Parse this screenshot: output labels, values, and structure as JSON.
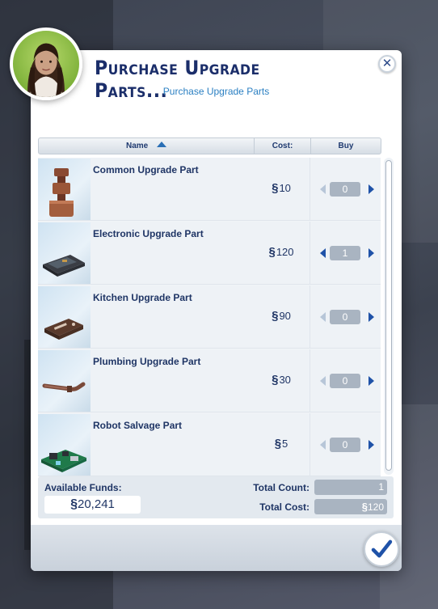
{
  "dialog": {
    "title": "Purchase Upgrade Parts...",
    "subtitle": "Purchase Upgrade Parts",
    "close_icon": "close-icon",
    "confirm_icon": "checkmark-icon"
  },
  "table": {
    "headers": {
      "name": "Name",
      "cost": "Cost:",
      "buy": "Buy"
    },
    "sort": "ascending",
    "items": [
      {
        "name": "Common Upgrade Part",
        "currency": "§",
        "cost": "10",
        "qty": "0",
        "icon": "copper-stack-icon"
      },
      {
        "name": "Electronic Upgrade Part",
        "currency": "§",
        "cost": "120",
        "qty": "1",
        "icon": "circuit-board-icon"
      },
      {
        "name": "Kitchen Upgrade Part",
        "currency": "§",
        "cost": "90",
        "qty": "0",
        "icon": "heating-plate-icon"
      },
      {
        "name": "Plumbing Upgrade Part",
        "currency": "§",
        "cost": "30",
        "qty": "0",
        "icon": "pipe-icon"
      },
      {
        "name": "Robot Salvage Part",
        "currency": "§",
        "cost": "5",
        "qty": "0",
        "icon": "green-chip-icon"
      }
    ]
  },
  "totals": {
    "funds_label": "Available Funds:",
    "funds_currency": "§",
    "funds_value": "20,241",
    "count_label": "Total Count:",
    "count_value": "1",
    "cost_label": "Total Cost:",
    "cost_currency": "§",
    "cost_value": "120"
  },
  "colors": {
    "title": "#1b2e6a",
    "subtitle": "#2a7fc2",
    "accent": "#1f52a8",
    "qty_box": "#a9b4c1"
  }
}
